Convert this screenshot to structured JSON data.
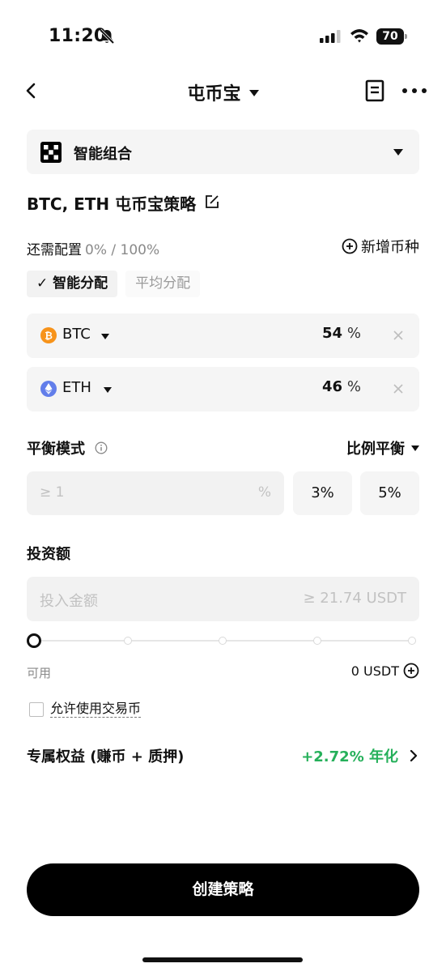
{
  "status_bar": {
    "time": "11:20",
    "battery_level": "70"
  },
  "nav": {
    "title": "屯币宝"
  },
  "selector": {
    "label": "智能组合"
  },
  "strategy": {
    "title": "BTC, ETH 屯币宝策略"
  },
  "config": {
    "label": "还需配置",
    "progress": "0% / 100%",
    "add_coin_label": "新增币种"
  },
  "allocation": {
    "tabs": [
      {
        "label": "✓ 智能分配",
        "active": true
      },
      {
        "label": "平均分配",
        "active": false
      }
    ]
  },
  "coins": [
    {
      "name": "BTC",
      "percent": "54",
      "unit": "%",
      "color": "#f7931a",
      "icon": "btc-icon"
    },
    {
      "name": "ETH",
      "percent": "46",
      "unit": "%",
      "color": "#627eea",
      "icon": "eth-icon"
    }
  ],
  "balance": {
    "label": "平衡模式",
    "mode": "比例平衡",
    "threshold_placeholder": "≥ 1",
    "threshold_unit": "%",
    "presets": [
      "3%",
      "5%"
    ]
  },
  "investment": {
    "label": "投资额",
    "placeholder": "投入金额",
    "minimum": "≥ 21.74 USDT",
    "slider_value": 0,
    "available_label": "可用",
    "available_value": "0 USDT"
  },
  "allow_trading_coin": {
    "label": "允许使用交易币",
    "checked": false
  },
  "benefit": {
    "label": "专属权益 (赚币 + 质押)",
    "rate": "+2.72% 年化",
    "rate_color": "#25b05a"
  },
  "cta": {
    "label": "创建策略"
  }
}
